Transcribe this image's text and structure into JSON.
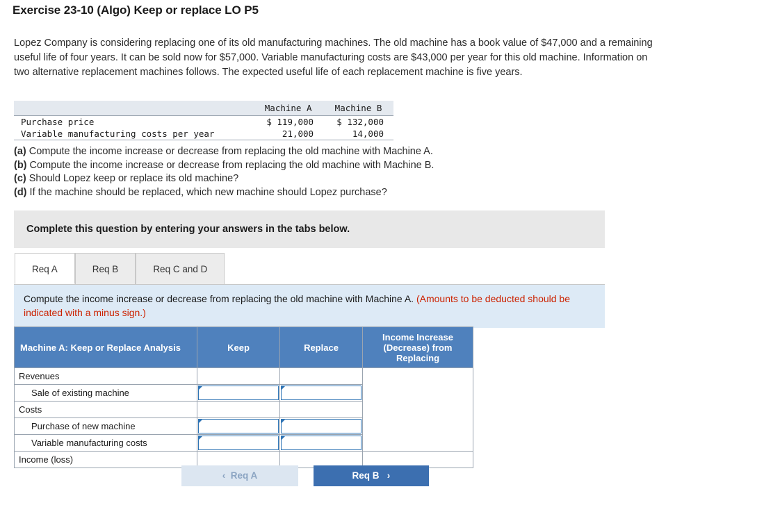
{
  "title": "Exercise 23-10 (Algo) Keep or replace LO P5",
  "intro": "Lopez Company is considering replacing one of its old manufacturing machines. The old machine has a book value of $47,000 and a remaining useful life of four years. It can be sold now for $57,000. Variable manufacturing costs are $43,000 per year for this old machine. Information on two alternative replacement machines follows. The expected useful life of each replacement machine is five years.",
  "machine_table": {
    "headers": [
      "",
      "Machine A",
      "Machine B"
    ],
    "rows": [
      {
        "label": "Purchase price",
        "a": "$ 119,000",
        "b": "$ 132,000"
      },
      {
        "label": "Variable manufacturing costs per year",
        "a": "21,000",
        "b": "14,000"
      }
    ]
  },
  "questions": [
    {
      "letter": "(a)",
      "text": " Compute the income increase or decrease from replacing the old machine with Machine A."
    },
    {
      "letter": "(b)",
      "text": " Compute the income increase or decrease from replacing the old machine with Machine B."
    },
    {
      "letter": "(c)",
      "text": " Should Lopez keep or replace its old machine?"
    },
    {
      "letter": "(d)",
      "text": " If the machine should be replaced, which new machine should Lopez purchase?"
    }
  ],
  "instruction_bar": "Complete this question by entering your answers in the tabs below.",
  "tabs": [
    {
      "label": "Req A",
      "active": true
    },
    {
      "label": "Req B",
      "active": false
    },
    {
      "label": "Req C and D",
      "active": false
    }
  ],
  "prompt": {
    "main": "Compute the income increase or decrease from replacing the old machine with Machine A. ",
    "note": "(Amounts to be deducted should be indicated with a minus sign.)"
  },
  "answer_grid": {
    "headers": {
      "first": "Machine A: Keep or Replace Analysis",
      "keep": "Keep",
      "replace": "Replace",
      "income": "Income Increase (Decrease) from Replacing"
    },
    "rows": [
      {
        "label": "Revenues",
        "indent": false,
        "keep_input": false,
        "replace_input": false
      },
      {
        "label": "Sale of existing machine",
        "indent": true,
        "keep_input": true,
        "replace_input": true
      },
      {
        "label": "Costs",
        "indent": false,
        "keep_input": false,
        "replace_input": false
      },
      {
        "label": "Purchase of new machine",
        "indent": true,
        "keep_input": true,
        "replace_input": true
      },
      {
        "label": "Variable manufacturing costs",
        "indent": true,
        "keep_input": true,
        "replace_input": true
      },
      {
        "label": "Income (loss)",
        "indent": false,
        "keep_input": false,
        "replace_input": false
      }
    ]
  },
  "nav": {
    "prev_label": "Req A",
    "prev_chevron": "‹",
    "next_label": "Req B",
    "next_chevron": "›"
  },
  "colors": {
    "header_blue": "#4f81bd",
    "prompt_blue": "#ddeaf6",
    "note_red": "#cc2200",
    "button_blue": "#3c6fb0",
    "button_disabled": "#dce6f1"
  }
}
